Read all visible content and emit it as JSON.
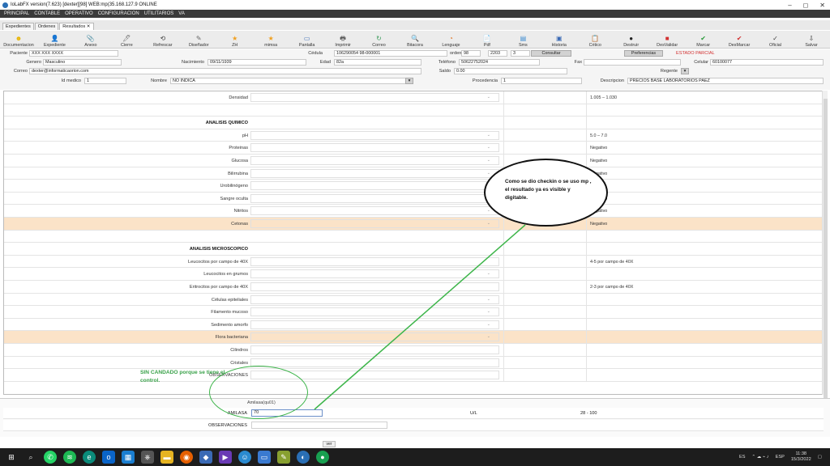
{
  "window": {
    "title": "IoLabFX version(7.623)  [dexter][98] WEB:mp(35.168.127.9 ONLINE",
    "min": "–",
    "max": "◻",
    "close": "✕"
  },
  "menu": [
    "PRINCIPAL",
    "CONTABLE",
    "OPERATIVO",
    "CONFIGURACION",
    "UTILITARIOS",
    "VA"
  ],
  "tabs": [
    "Expedientes",
    "Ordenes",
    "Resultados ✕"
  ],
  "toolbar": [
    {
      "label": "Documentacion",
      "icon": "☻",
      "color": "#e8b400"
    },
    {
      "label": "Expediente",
      "icon": "👤",
      "color": "#2a4f9a"
    },
    {
      "label": "Anexo",
      "icon": "📎",
      "color": "#4a6a9a"
    },
    {
      "label": "Cierre",
      "icon": "🖊",
      "color": "#666"
    },
    {
      "label": "Refrescar",
      "icon": "⟲",
      "color": "#444"
    },
    {
      "label": "Diseñador",
      "icon": "✎",
      "color": "#666"
    },
    {
      "label": "ZH",
      "icon": "★",
      "color": "#f0a020"
    },
    {
      "label": "mimsa",
      "icon": "★",
      "color": "#f0a020"
    },
    {
      "label": "Pantalla",
      "icon": "▭",
      "color": "#3a6ab5"
    },
    {
      "label": "Imprimir",
      "icon": "🖶",
      "color": "#555"
    },
    {
      "label": "Correo",
      "icon": "↻",
      "color": "#3a9a5a"
    },
    {
      "label": "Bitacora",
      "icon": "🔍",
      "color": "#555"
    },
    {
      "label": "Lenguaje",
      "icon": "◔",
      "color": "#e07020"
    },
    {
      "label": "Pdf",
      "icon": "📄",
      "color": "#d23030"
    },
    {
      "label": "Sms",
      "icon": "▤",
      "color": "#3a8ad0"
    },
    {
      "label": "Historia",
      "icon": "▣",
      "color": "#3a6ab5"
    },
    {
      "label": "Critico",
      "icon": "📋",
      "color": "#555"
    },
    {
      "label": "Destruir",
      "icon": "●",
      "color": "#222"
    },
    {
      "label": "DesValidar",
      "icon": "■",
      "color": "#d23030"
    },
    {
      "label": "Marcar",
      "icon": "✔",
      "color": "#2a9a3a"
    },
    {
      "label": "DesMarcar",
      "icon": "✔",
      "color": "#d23030"
    },
    {
      "label": "Oficial",
      "icon": "✓",
      "color": "#444"
    },
    {
      "label": "Salvar",
      "icon": "⇩",
      "color": "#444"
    }
  ],
  "form": {
    "paciente_lbl": "Paciente",
    "paciente": "XXX XXX XXXX",
    "cedula_lbl": "Cédula",
    "cedula": "106290054  98-000001",
    "orden_lbl": "orden",
    "orden1": "98",
    "orden2": "2203",
    "orden3": "3",
    "consultar": "Consultar",
    "preferencias": "Preferencias",
    "estado": "ESTADO PARCIAL",
    "genero_lbl": "Genero",
    "genero": "Masculino",
    "nacimiento_lbl": "Nacimiento",
    "nacimiento": "09/11/1939",
    "edad_lbl": "Edad",
    "edad": "82a",
    "telefono_lbl": "Teléfono",
    "telefono": "50622752024",
    "fax_lbl": "Fax",
    "fax": "",
    "celular_lbl": "Celular",
    "celular": "60100077",
    "correo_lbl": "Correo",
    "correo": "dexter@informaticaorion.com",
    "saldo_lbl": "Saldo",
    "saldo": "0.00",
    "regente_lbl": "Regente",
    "idmedico_lbl": "Id medico",
    "idmedico": "1",
    "nombre_lbl": "Nombre",
    "nombre": "NO INDICA",
    "procedencia_lbl": "Procedencia",
    "procedencia": "1",
    "descripcion_lbl": "Descripcion",
    "descripcion": "PRECIOS BASE LABORATORIOS PAEZ"
  },
  "rows": [
    {
      "name": "Densidad",
      "ref": "1.005 – 1.030",
      "dd": true,
      "sec": false,
      "hl": false
    },
    {
      "name": "",
      "ref": "",
      "dd": false,
      "sec": false,
      "hl": false
    },
    {
      "name": "ANALISIS QUIMICO",
      "ref": "",
      "dd": false,
      "sec": true,
      "hl": false
    },
    {
      "name": "pH",
      "ref": "5.0 – 7.0",
      "dd": true,
      "sec": false,
      "hl": false
    },
    {
      "name": "Proteinas",
      "ref": "Negativo",
      "dd": true,
      "sec": false,
      "hl": false
    },
    {
      "name": "Glucosa",
      "ref": "Negativo",
      "dd": true,
      "sec": false,
      "hl": false
    },
    {
      "name": "Bilirrubina",
      "ref": "Negativo",
      "dd": true,
      "sec": false,
      "hl": false
    },
    {
      "name": "Urobilinógeno",
      "ref": "Normal",
      "dd": false,
      "sec": false,
      "hl": false
    },
    {
      "name": "Sangre oculta",
      "ref": "Negativo",
      "dd": false,
      "sec": false,
      "hl": false
    },
    {
      "name": "Nitritos",
      "ref": "Negativo",
      "dd": true,
      "sec": false,
      "hl": false
    },
    {
      "name": "Cetonas",
      "ref": "Negativo",
      "dd": true,
      "sec": false,
      "hl": true
    },
    {
      "name": "",
      "ref": "",
      "dd": false,
      "sec": false,
      "hl": false
    },
    {
      "name": "ANALISIS MICROSCOPICO",
      "ref": "",
      "dd": false,
      "sec": true,
      "hl": false
    },
    {
      "name": "Leucocitos por campo de 40X",
      "ref": "4-5 por campo de 40X",
      "dd": false,
      "sec": false,
      "hl": false
    },
    {
      "name": "Leucocitos en grumos",
      "ref": "",
      "dd": true,
      "sec": false,
      "hl": false
    },
    {
      "name": "Eritrocitos por campo de 40X",
      "ref": "2-3 por campo de 40X",
      "dd": false,
      "sec": false,
      "hl": false
    },
    {
      "name": "Células epiteliales",
      "ref": "",
      "dd": true,
      "sec": false,
      "hl": false
    },
    {
      "name": "Filamento mucoso",
      "ref": "",
      "dd": true,
      "sec": false,
      "hl": false
    },
    {
      "name": "Sedimento amorfo",
      "ref": "",
      "dd": true,
      "sec": false,
      "hl": false
    },
    {
      "name": "Flora bacteriana",
      "ref": "",
      "dd": true,
      "sec": false,
      "hl": true
    },
    {
      "name": "Cilindros",
      "ref": "",
      "dd": false,
      "sec": false,
      "hl": false
    },
    {
      "name": "Cristales",
      "ref": "",
      "dd": false,
      "sec": false,
      "hl": false
    },
    {
      "name": "OBSERVACIONES",
      "ref": "",
      "dd": false,
      "sec": false,
      "hl": false
    }
  ],
  "bottom": {
    "header": "Amilasa(qu01)",
    "amilasa_lbl": "AMILASA",
    "amilasa_val": "70",
    "unit": "U/L",
    "ref": "28 - 100",
    "obs_lbl": "OBSERVACIONES"
  },
  "annotations": {
    "callout": "Como se dio checkin o se uso mp , el resultado ya es visible y digitable.",
    "green": "SIN CANDADO porque se tiene el control."
  },
  "ver_label": "ver",
  "tray": {
    "lang": "ES",
    "kbd": "ESP",
    "time": "11:38",
    "date": "15/3/2022"
  }
}
